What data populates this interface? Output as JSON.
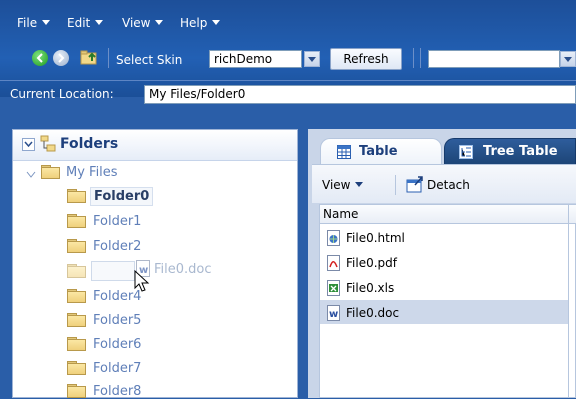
{
  "menubar": {
    "file": "File",
    "edit": "Edit",
    "view": "View",
    "help": "Help"
  },
  "toolbar": {
    "select_skin_label": "Select Skin",
    "skin_value": "richDemo",
    "refresh_label": "Refresh",
    "second_select_value": ""
  },
  "location": {
    "label": "Current Location:",
    "value": "My Files/Folder0"
  },
  "left_panel": {
    "title": "Folders",
    "root": "My Files",
    "folders": [
      "Folder0",
      "Folder1",
      "Folder2",
      "Folder4",
      "Folder5",
      "Folder6",
      "Folder7",
      "Folder8"
    ],
    "selected_folder": "Folder0",
    "drag_label": "File0.doc"
  },
  "right_panel": {
    "tabs": [
      "Table",
      "Tree Table"
    ],
    "view_menu": "View",
    "detach": "Detach",
    "column_name": "Name",
    "files": [
      "File0.html",
      "File0.pdf",
      "File0.xls",
      "File0.doc"
    ],
    "selected_file": "File0.doc"
  },
  "colors": {
    "header_blue": "#2260b4",
    "selection": "#c9d5ea",
    "folder_yellow": "#f2d98a"
  }
}
